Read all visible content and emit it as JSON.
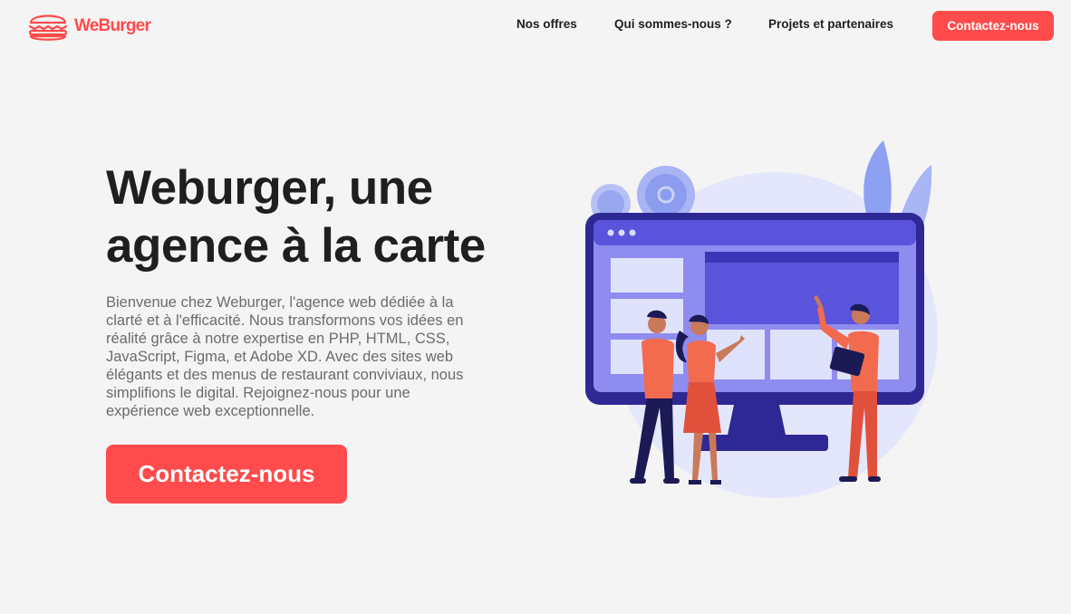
{
  "header": {
    "logo_text": "WeBurger",
    "nav": [
      {
        "label": "Nos offres"
      },
      {
        "label": "Qui sommes-nous ?"
      },
      {
        "label": "Projets et partenaires"
      }
    ],
    "cta_label": "Contactez-nous"
  },
  "hero": {
    "title_line1": "Weburger, une",
    "title_line2": "agence à la carte",
    "description": "Bienvenue chez Weburger, l'agence web dédiée à la clarté et à l'efficacité. Nous transformons vos idées en réalité grâce à notre expertise en PHP, HTML, CSS, JavaScript, Figma, et Adobe XD. Avec des sites web élégants et des menus de restaurant conviviaux, nous simplifions le digital. Rejoignez-nous pour une expérience web exceptionnelle.",
    "cta_label": "Contactez-nous"
  },
  "theme": {
    "accent": "#ff4b4b",
    "text": "#1f1f1f",
    "muted": "#6b6b6b",
    "background": "#f4f4f4",
    "illustration_primary": "#4b45d6",
    "illustration_secondary": "#f26b4f"
  },
  "icons": {
    "logo": "burger-icon",
    "illustration": "team-at-monitor-illustration"
  }
}
